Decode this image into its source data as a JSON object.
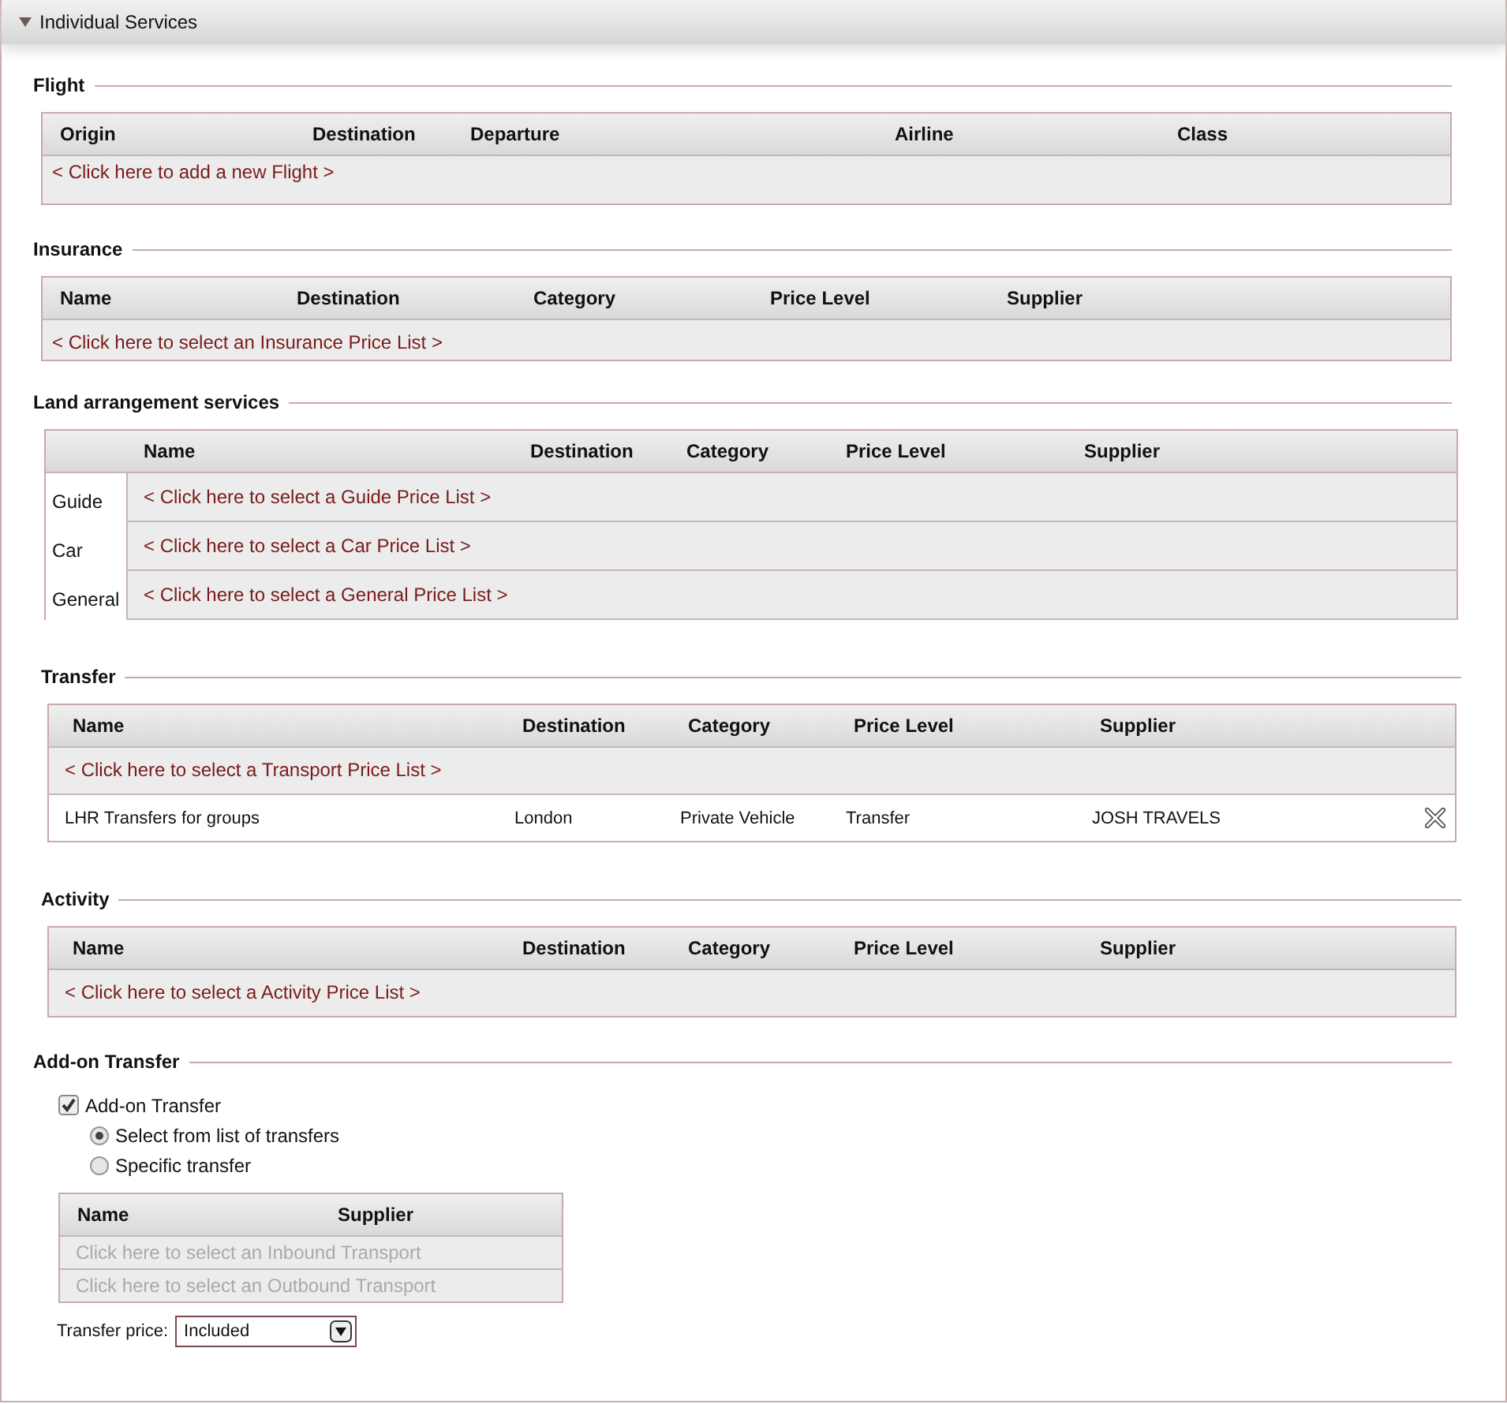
{
  "panel": {
    "title": "Individual Services",
    "expanded": true
  },
  "sections": [
    {
      "kind": "table",
      "title": "Flight",
      "columns": [
        "Origin",
        "Destination",
        "Departure",
        "Airline",
        "Class"
      ],
      "rows": [
        {
          "kind": "link",
          "text": "< Click here to add a new Flight >"
        }
      ]
    },
    {
      "kind": "table",
      "title": "Insurance",
      "columns": [
        "Name",
        "Destination",
        "Category",
        "Price Level",
        "Supplier"
      ],
      "rows": [
        {
          "kind": "link",
          "text": "< Click here to select an Insurance Price List >"
        }
      ]
    },
    {
      "kind": "labeled",
      "title": "Land arrangement services",
      "columns": [
        "Name",
        "Destination",
        "Category",
        "Price Level",
        "Supplier"
      ],
      "rows": [
        {
          "kind": "link",
          "label": "Guide",
          "text": "< Click here to select a Guide Price List >"
        },
        {
          "kind": "link",
          "label": "Car",
          "text": "< Click here to select a Car Price List >"
        },
        {
          "kind": "link",
          "label": "General",
          "text": "< Click here to select a General Price List >"
        }
      ]
    },
    {
      "kind": "table",
      "title": "Transfer",
      "columns": [
        "Name",
        "Destination",
        "Category",
        "Price Level",
        "Supplier"
      ],
      "rows": [
        {
          "kind": "link",
          "text": "< Click here to select a Transport Price List >"
        },
        {
          "kind": "data",
          "cells": [
            "LHR Transfers for groups",
            "London",
            "Private Vehicle",
            "Transfer",
            "JOSH TRAVELS"
          ]
        }
      ]
    },
    {
      "kind": "table",
      "title": "Activity",
      "columns": [
        "Name",
        "Destination",
        "Category",
        "Price Level",
        "Supplier"
      ],
      "rows": [
        {
          "kind": "link",
          "text": "< Click here to select a Activity Price List >"
        }
      ]
    },
    {
      "kind": "addon",
      "title": "Add-on Transfer",
      "checkbox": {
        "label": "Add-on Transfer",
        "checked": true
      },
      "options": [
        {
          "label": "Select from list of transfers",
          "selected": true
        },
        {
          "label": "Specific transfer",
          "selected": false
        }
      ],
      "columns": [
        "Name",
        "Supplier"
      ],
      "rows": [
        "Click here to select an Inbound Transport",
        "Click here to select an Outbound Transport"
      ],
      "price": {
        "label": "Transfer price:",
        "value": "Included"
      }
    }
  ]
}
